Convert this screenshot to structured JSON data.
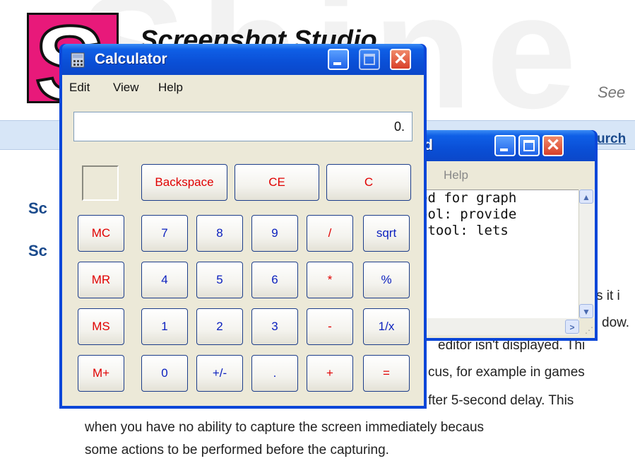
{
  "site": {
    "title": "Screenshot Studio",
    "tagline": "See",
    "nav_link": "urch",
    "headings": [
      "Sc",
      "Sc"
    ],
    "body_lines": [
      "s it i",
      "dow.",
      "editor isn't displayed. Thi",
      "cus, for example in games",
      "fter 5-second delay. This",
      "when you have no ability to capture the screen immediately becaus",
      "some actions to be performed before the capturing."
    ]
  },
  "notepad": {
    "title_fragment": "d",
    "menu": [
      "Help"
    ],
    "text_lines": [
      "ed for graph",
      "ool: provide",
      " tool: lets"
    ]
  },
  "calculator": {
    "title": "Calculator",
    "menu": [
      "Edit",
      "View",
      "Help"
    ],
    "display": "0.",
    "top_buttons": [
      "Backspace",
      "CE",
      "C"
    ],
    "memory_buttons": [
      "MC",
      "MR",
      "MS",
      "M+"
    ],
    "rows": [
      [
        "7",
        "8",
        "9",
        "/",
        "sqrt"
      ],
      [
        "4",
        "5",
        "6",
        "*",
        "%"
      ],
      [
        "1",
        "2",
        "3",
        "-",
        "1/x"
      ],
      [
        "0",
        "+/-",
        ".",
        "+",
        "="
      ]
    ]
  }
}
